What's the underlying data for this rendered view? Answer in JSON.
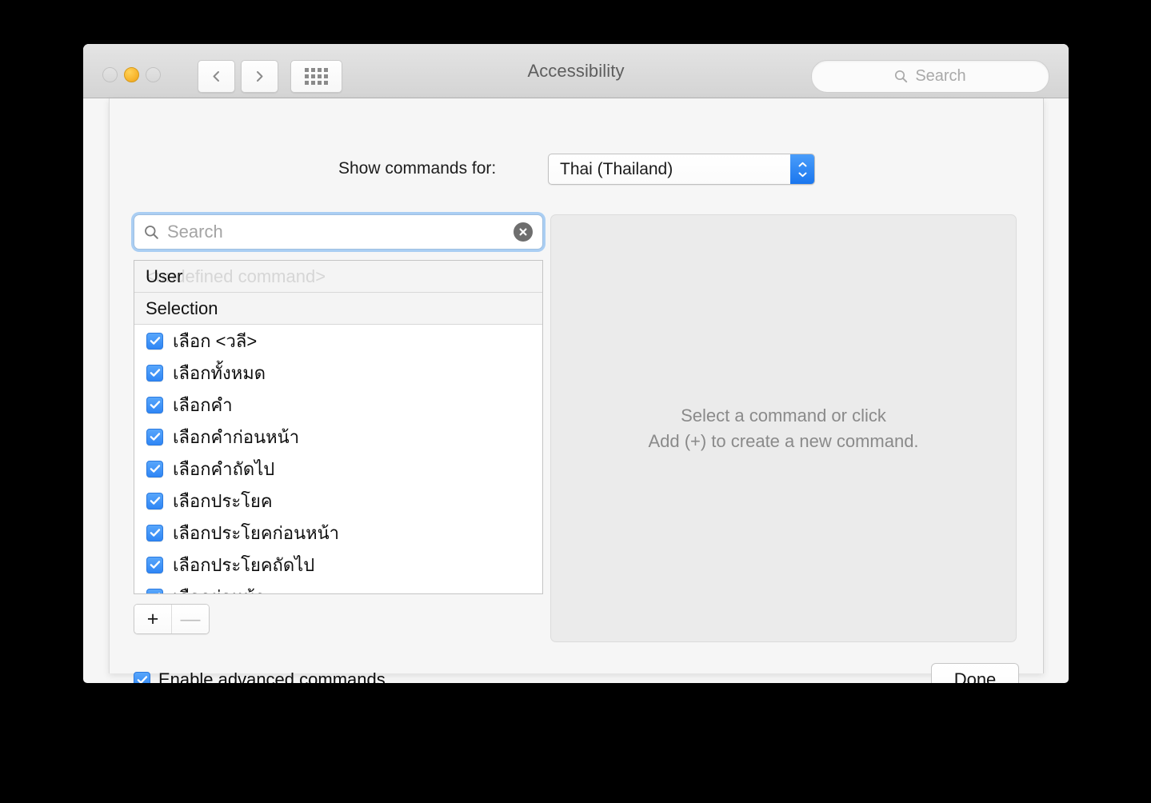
{
  "window": {
    "title": "Accessibility",
    "traffic_lights": [
      "close-button",
      "minimize-button",
      "zoom-button"
    ],
    "nav": {
      "back": "back-icon",
      "forward": "forward-icon",
      "show_all": "grid-icon"
    },
    "toolbar_search": {
      "placeholder": "Search",
      "icon": "search-icon"
    }
  },
  "popup": {
    "label": "Show commands for:",
    "selected": "Thai (Thailand)",
    "options": [
      "Thai (Thailand)"
    ]
  },
  "search": {
    "placeholder": "Search",
    "value": "",
    "icon": "search-icon",
    "clear_icon": "clear-circle-icon"
  },
  "list": {
    "headers": [
      {
        "label": "User",
        "ghost": "<undefined command>"
      },
      {
        "label": "Selection",
        "ghost": ""
      }
    ],
    "items": [
      {
        "label": "เลือก <วลี>",
        "checked": true
      },
      {
        "label": "เลือกทั้งหมด",
        "checked": true
      },
      {
        "label": "เลือกคำ",
        "checked": true
      },
      {
        "label": "เลือกคำก่อนหน้า",
        "checked": true
      },
      {
        "label": "เลือกคำถัดไป",
        "checked": true
      },
      {
        "label": "เลือกประโยค",
        "checked": true
      },
      {
        "label": "เลือกประโยคก่อนหน้า",
        "checked": true
      },
      {
        "label": "เลือกประโยคถัดไป",
        "checked": true
      },
      {
        "label": "เลือกย่อหน้า",
        "checked": true
      }
    ]
  },
  "segmented": {
    "add": "+",
    "remove": "—"
  },
  "detail": {
    "line1": "Select a command or click",
    "line2": "Add (+) to create a new command."
  },
  "footer": {
    "advanced_label": "Enable advanced commands",
    "advanced_checked": true,
    "done_label": "Done"
  },
  "colors": {
    "accent": "#2f86f5",
    "titlebar": "#d9d9d9",
    "sheet_bg": "#f6f6f6",
    "detail_bg": "#ebebeb"
  }
}
